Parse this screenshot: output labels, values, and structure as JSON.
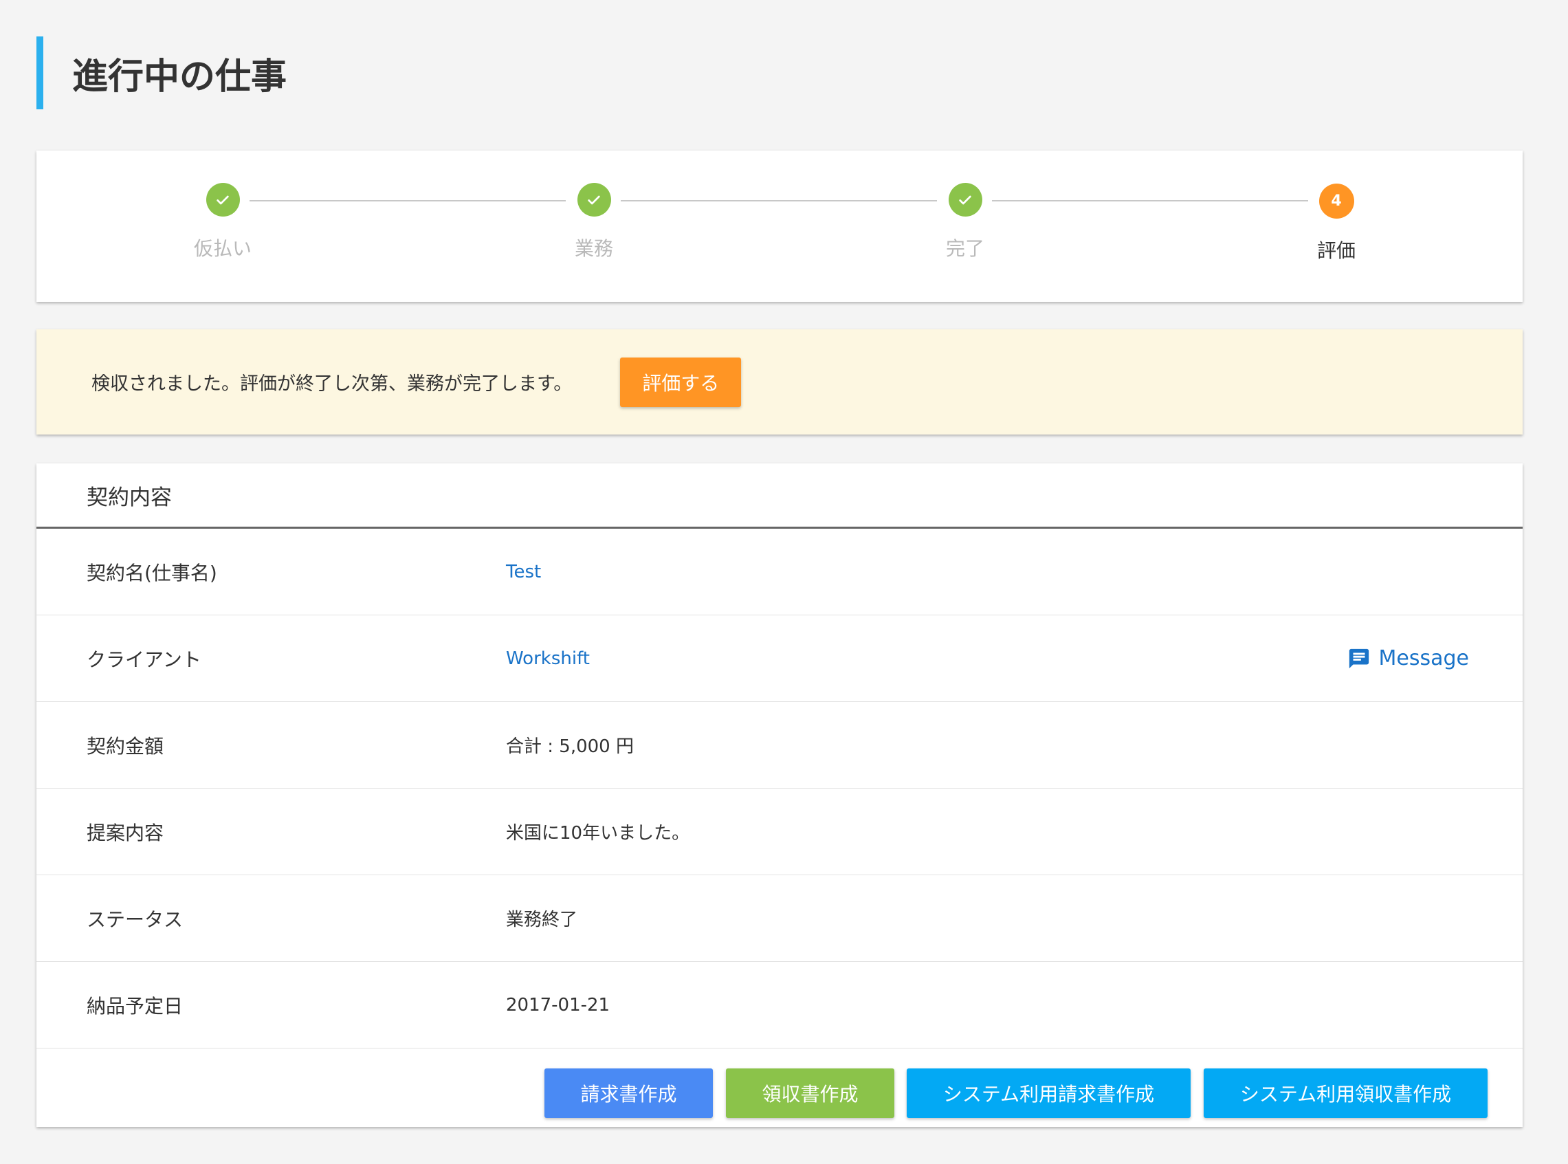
{
  "page": {
    "title": "進行中の仕事"
  },
  "stepper": {
    "steps": [
      {
        "label": "仮払い",
        "status": "done",
        "icon": "check-icon"
      },
      {
        "label": "業務",
        "status": "done",
        "icon": "check-icon"
      },
      {
        "label": "完了",
        "status": "done",
        "icon": "check-icon"
      },
      {
        "label": "評価",
        "status": "active",
        "number": "4"
      }
    ]
  },
  "notice": {
    "text": "検収されました。評価が終了し次第、業務が完了します。",
    "button_label": "評価する"
  },
  "contract": {
    "title": "契約内容",
    "rows": [
      {
        "label": "契約名(仕事名)",
        "value": "Test"
      },
      {
        "label": "クライアント",
        "value": "Workshift",
        "message_label": "Message"
      },
      {
        "label": "契約金額",
        "value": "合計 : 5,000 円"
      },
      {
        "label": "提案内容",
        "value": "米国に10年いました。"
      },
      {
        "label": "ステータス",
        "value": "業務終了"
      },
      {
        "label": "納品予定日",
        "value": "2017-01-21"
      }
    ],
    "actions": {
      "invoice": "請求書作成",
      "receipt": "領収書作成",
      "system_invoice": "システム利用請求書作成",
      "system_receipt": "システム利用領収書作成"
    }
  },
  "colors": {
    "accent_bar": "#2bb0ee",
    "done": "#8bc34a",
    "active": "#ff9524",
    "link": "#1a73c8",
    "invoice_button": "#4a8af4",
    "receipt_button": "#8bc34a",
    "system_button": "#03a9f4"
  }
}
